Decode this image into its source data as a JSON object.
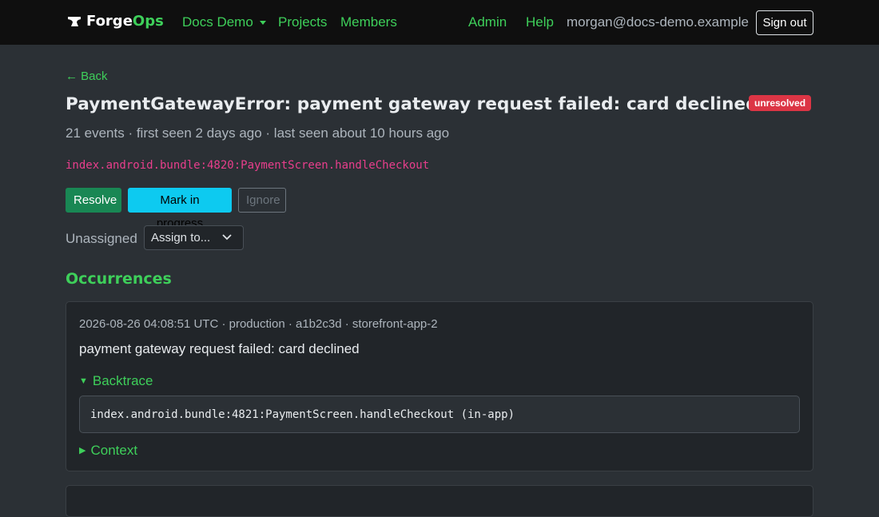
{
  "nav": {
    "brand_forge": "Forge",
    "brand_ops": "Ops",
    "org_switcher": "Docs Demo",
    "projects": "Projects",
    "members": "Members",
    "admin": "Admin",
    "help": "Help",
    "user_email": "morgan@docs-demo.example",
    "sign_out": "Sign out"
  },
  "issue": {
    "back": "← Back",
    "title": "PaymentGatewayError: payment gateway request failed: card declined",
    "status": "unresolved",
    "summary": "21 events · first seen 2 days ago · last seen about 10 hours ago",
    "culprit": "index.android.bundle:4820:PaymentScreen.handleCheckout",
    "actions": {
      "resolve": "Resolve",
      "in_progress": "Mark in progress",
      "ignore": "Ignore"
    },
    "assignee": "Unassigned",
    "assign_placeholder": "Assign to..."
  },
  "occurrences": {
    "heading": "Occurrences",
    "items": [
      {
        "meta": "2026-08-26 04:08:51 UTC · production · a1b2c3d · storefront-app-2",
        "message": "payment gateway request failed: card declined",
        "backtrace_label": "Backtrace",
        "frames": [
          "index.android.bundle:4821:PaymentScreen.handleCheckout (in-app)"
        ],
        "context_label": "Context"
      }
    ]
  },
  "colors": {
    "accent": "#3ecf5a",
    "danger": "#dc3545",
    "success": "#198754",
    "info": "#0dcaf0",
    "culprit": "#e83e8c"
  }
}
